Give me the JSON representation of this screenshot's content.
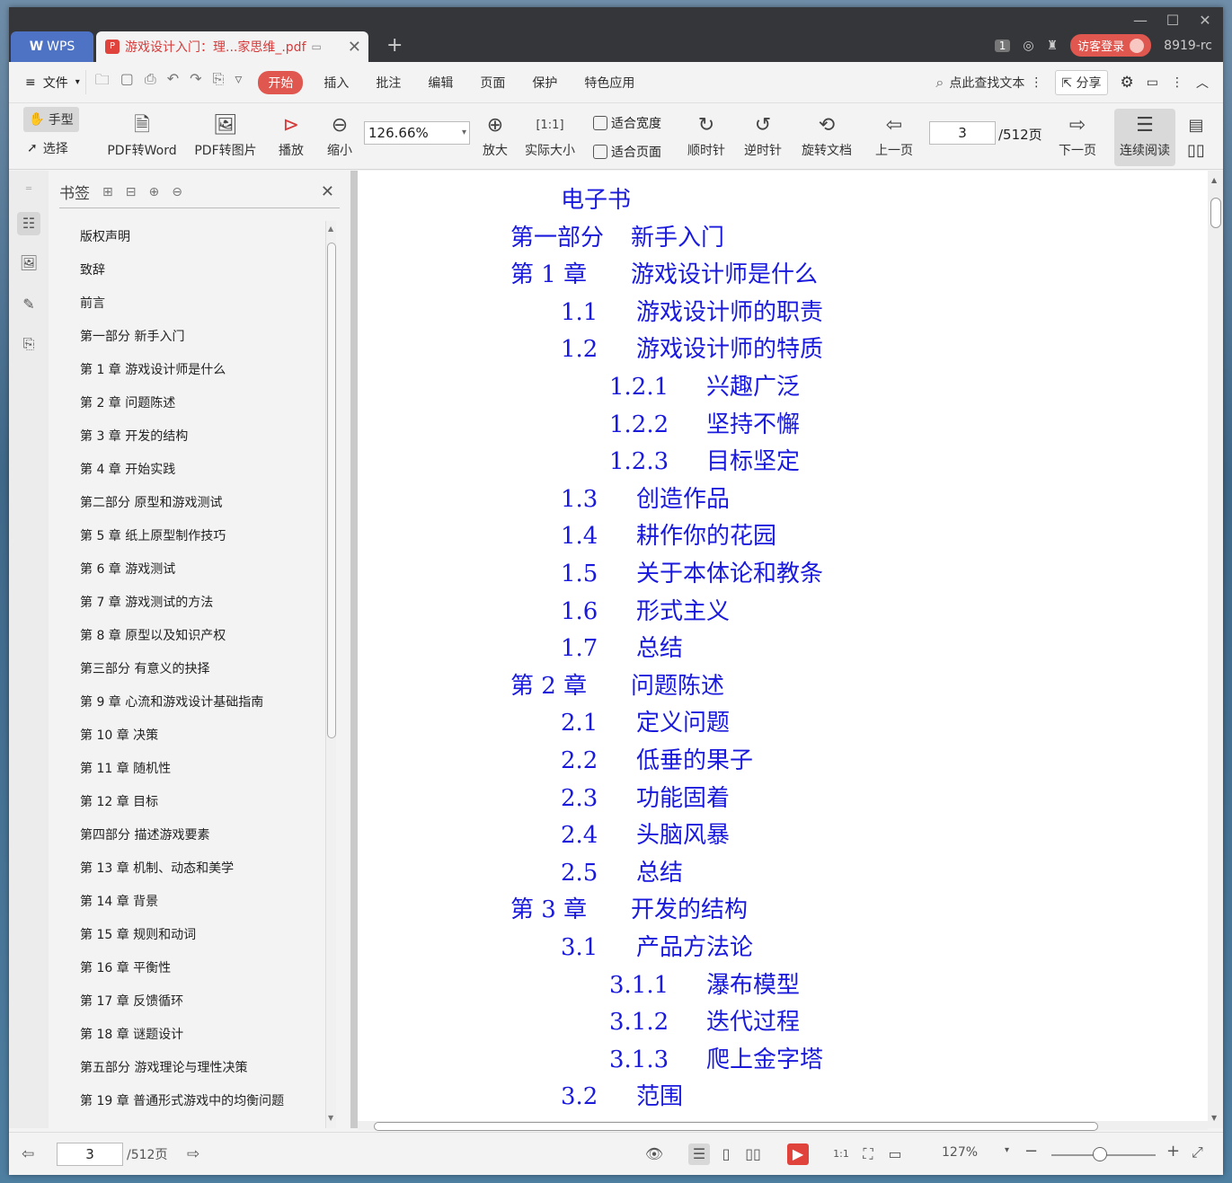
{
  "titlebar": {
    "wps_tab_label": "WPS",
    "doc_tab_label": "游戏设计入门：理...家思维_.pdf",
    "add_tab_symbol": "+",
    "page_count_badge": "1",
    "login_label": "访客登录",
    "user_label": "8919-rc"
  },
  "menubar": {
    "file_label": "文件",
    "tabs": [
      "开始",
      "插入",
      "批注",
      "编辑",
      "页面",
      "保护",
      "特色应用"
    ],
    "search_label": "点此查找文本",
    "share_label": "分享"
  },
  "toolbar": {
    "hand_label": "手型",
    "select_label": "选择",
    "pdf_to_word_label": "PDF转Word",
    "pdf_to_image_label": "PDF转图片",
    "play_label": "播放",
    "zoom_out_label": "缩小",
    "zoom_value": "126.66%",
    "zoom_in_label": "放大",
    "actual_size_label": "实际大小",
    "fit_width_label": "适合宽度",
    "fit_page_label": "适合页面",
    "clockwise_label": "顺时针",
    "counterclockwise_label": "逆时针",
    "rotate_doc_label": "旋转文档",
    "prev_page_label": "上一页",
    "current_page": "3",
    "total_pages": "/512页",
    "next_page_label": "下一页",
    "continuous_label": "连续阅读"
  },
  "bookmarks": {
    "title": "书签",
    "items": [
      "版权声明",
      "致辞",
      "前言",
      "第一部分 新手入门",
      "第 1 章 游戏设计师是什么",
      "第 2 章 问题陈述",
      "第 3 章 开发的结构",
      "第 4 章 开始实践",
      "第二部分 原型和游戏测试",
      "第 5 章 纸上原型制作技巧",
      "第 6 章 游戏测试",
      "第 7 章 游戏测试的方法",
      "第 8 章 原型以及知识产权",
      "第三部分 有意义的抉择",
      "第 9 章 心流和游戏设计基础指南",
      "第 10 章 决策",
      "第 11 章 随机性",
      "第 12 章 目标",
      "第四部分 描述游戏要素",
      "第 13 章 机制、动态和美学",
      "第 14 章 背景",
      "第 15 章 规则和动词",
      "第 16 章 平衡性",
      "第 17 章 反馈循环",
      "第 18 章 谜题设计",
      "第五部分 游戏理论与理性决策",
      "第 19 章 普通形式游戏中的均衡问题"
    ]
  },
  "document": {
    "toc": [
      {
        "num": "",
        "text": "电子书",
        "level": 1
      },
      {
        "num": "第一部分",
        "text": "新手入门",
        "level": 0
      },
      {
        "num": "第 1 章",
        "text": "游戏设计师是什么",
        "level": 0
      },
      {
        "num": "1.1",
        "text": "游戏设计师的职责",
        "level": 1
      },
      {
        "num": "1.2",
        "text": "游戏设计师的特质",
        "level": 1
      },
      {
        "num": "1.2.1",
        "text": "兴趣广泛",
        "level": 2
      },
      {
        "num": "1.2.2",
        "text": "坚持不懈",
        "level": 2
      },
      {
        "num": "1.2.3",
        "text": "目标坚定",
        "level": 2
      },
      {
        "num": "1.3",
        "text": "创造作品",
        "level": 1
      },
      {
        "num": "1.4",
        "text": "耕作你的花园",
        "level": 1
      },
      {
        "num": "1.5",
        "text": "关于本体论和教条",
        "level": 1
      },
      {
        "num": "1.6",
        "text": "形式主义",
        "level": 1
      },
      {
        "num": "1.7",
        "text": "总结",
        "level": 1
      },
      {
        "num": "第 2 章",
        "text": "问题陈述",
        "level": 0
      },
      {
        "num": "2.1",
        "text": "定义问题",
        "level": 1
      },
      {
        "num": "2.2",
        "text": "低垂的果子",
        "level": 1
      },
      {
        "num": "2.3",
        "text": "功能固着",
        "level": 1
      },
      {
        "num": "2.4",
        "text": "头脑风暴",
        "level": 1
      },
      {
        "num": "2.5",
        "text": "总结",
        "level": 1
      },
      {
        "num": "第 3 章",
        "text": "开发的结构",
        "level": 0
      },
      {
        "num": "3.1",
        "text": "产品方法论",
        "level": 1
      },
      {
        "num": "3.1.1",
        "text": "瀑布模型",
        "level": 2
      },
      {
        "num": "3.1.2",
        "text": "迭代过程",
        "level": 2
      },
      {
        "num": "3.1.3",
        "text": "爬上金字塔",
        "level": 2
      },
      {
        "num": "3.2",
        "text": "范围",
        "level": 1
      }
    ]
  },
  "statusbar": {
    "current_page": "3",
    "total_pages": "/512页",
    "zoom_value": "127%"
  },
  "colors": {
    "toc_text": "#1a1adc",
    "accent_red": "#e0574f",
    "wps_blue": "#4e73c4"
  }
}
